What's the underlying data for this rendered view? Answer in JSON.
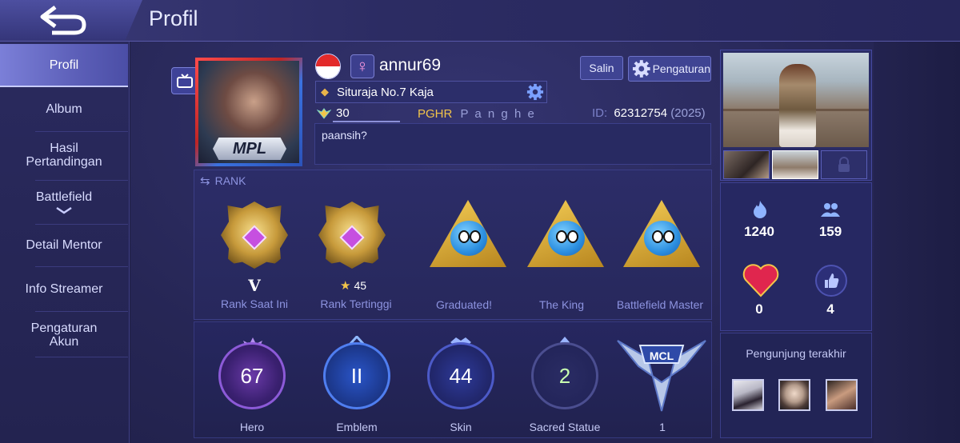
{
  "header": {
    "title": "Profil"
  },
  "sidebar": {
    "items": [
      {
        "label": "Profil"
      },
      {
        "label": "Album"
      },
      {
        "label": "Hasil Pertandingan"
      },
      {
        "label": "Battlefield"
      },
      {
        "label": "Detail Mentor"
      },
      {
        "label": "Info Streamer"
      },
      {
        "label": "Pengaturan Akun"
      }
    ]
  },
  "profile": {
    "avatar_frame_text": "MPL",
    "username": "annur69",
    "gender_symbol": "♀",
    "copy_label": "Salin",
    "settings_label": "Pengaturan",
    "squad": "Situraja No.7 Kaja",
    "level": "30",
    "guild_tag": "PGHR",
    "guild_name": "P a n g h e",
    "id_label": "ID:",
    "id_value": "62312754",
    "id_server": "(2025)",
    "bio": "paansih?"
  },
  "rank": {
    "header": "RANK",
    "current_tier": "V",
    "highest_stars": "45",
    "badges": [
      {
        "label": "Rank Saat Ini"
      },
      {
        "label": "Rank Tertinggi"
      },
      {
        "label": "Graduated!"
      },
      {
        "label": "The King"
      },
      {
        "label": "Battlefield Master"
      }
    ]
  },
  "stats": {
    "items": [
      {
        "value": "67",
        "label": "Hero"
      },
      {
        "value": "II",
        "label": "Emblem"
      },
      {
        "value": "44",
        "label": "Skin"
      },
      {
        "value": "2",
        "label": "Sacred Statue"
      },
      {
        "value": "1",
        "label": ""
      }
    ],
    "mcl_text": "MCL"
  },
  "side": {
    "popularity": "1240",
    "followers": "159",
    "likes_heart": "0",
    "thumbs": "4",
    "visitors_title": "Pengunjung terakhir"
  },
  "colors": {
    "accent": "#7b7fd8",
    "gold": "#f2c44a",
    "background": "#1f1f45"
  },
  "icons": [
    "back-arrow-icon",
    "tv-icon",
    "gear-icon",
    "flame-icon",
    "people-icon",
    "heart-icon",
    "thumbs-up-icon",
    "lock-icon"
  ]
}
